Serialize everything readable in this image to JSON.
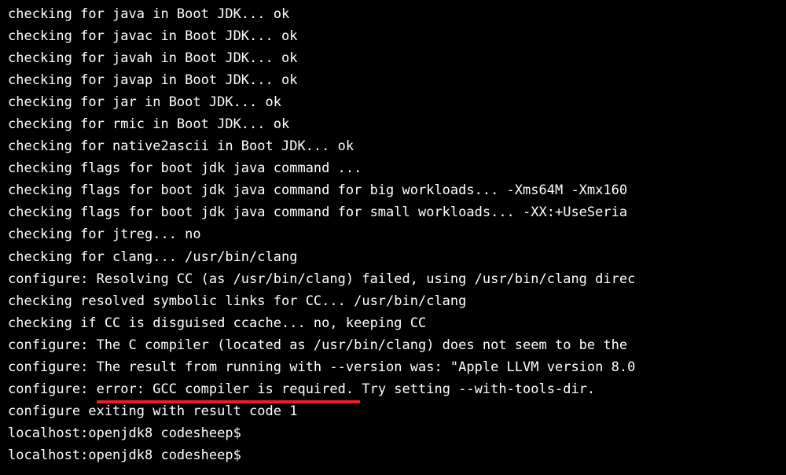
{
  "lines": {
    "l0": "checking for java in Boot JDK... ok",
    "l1": "checking for javac in Boot JDK... ok",
    "l2": "checking for javah in Boot JDK... ok",
    "l3": "checking for javap in Boot JDK... ok",
    "l4": "checking for jar in Boot JDK... ok",
    "l5": "checking for rmic in Boot JDK... ok",
    "l6": "checking for native2ascii in Boot JDK... ok",
    "l7": "checking flags for boot jdk java command ...",
    "l8": "checking flags for boot jdk java command for big workloads...  -Xms64M -Xmx160",
    "l9": "checking flags for boot jdk java command for small workloads...  -XX:+UseSeria",
    "l10": "checking for jtreg... no",
    "l11": "checking for clang... /usr/bin/clang",
    "l12": "configure: Resolving CC (as /usr/bin/clang) failed, using /usr/bin/clang direc",
    "l13": "checking resolved symbolic links for CC... /usr/bin/clang",
    "l14": "checking if CC is disguised ccache... no, keeping CC",
    "l15": "configure: The C compiler (located as /usr/bin/clang) does not seem to be the ",
    "l16": "configure: The result from running with --version was: \"Apple LLVM version 8.0",
    "l17_pre": "configure: ",
    "l17_highlight": "error: GCC compiler is required.",
    "l17_post": " Try setting --with-tools-dir.",
    "l18": "configure exiting with result code 1",
    "l19": "localhost:openjdk8 codesheep$",
    "l20": "localhost:openjdk8 codesheep$"
  }
}
